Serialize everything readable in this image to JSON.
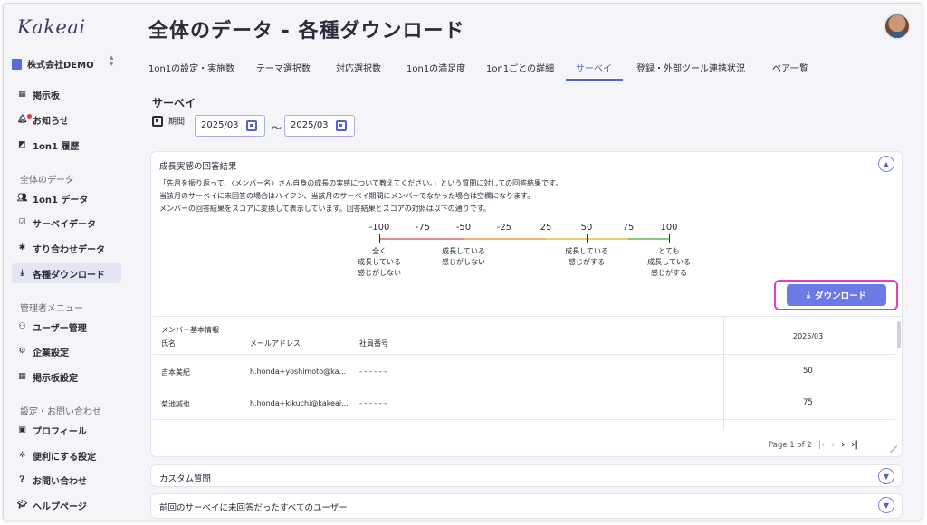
{
  "sidebar": {
    "logo": "Kakeai",
    "company": "株式会社DEMO",
    "items_top": [
      {
        "label": "掲示板",
        "icon": "board-icon"
      },
      {
        "label": "お知らせ",
        "icon": "bell-icon"
      },
      {
        "label": "1on1 履歴",
        "icon": "history-icon"
      }
    ],
    "section_data": "全体のデータ",
    "items_data": [
      {
        "label": "1on1 データ",
        "icon": "people-icon"
      },
      {
        "label": "サーベイデータ",
        "icon": "checkbox-icon"
      },
      {
        "label": "すり合わせデータ",
        "icon": "puzzle-icon"
      },
      {
        "label": "各種ダウンロード",
        "icon": "download-icon"
      }
    ],
    "section_admin": "管理者メニュー",
    "items_admin": [
      {
        "label": "ユーザー管理",
        "icon": "users-icon"
      },
      {
        "label": "企業設定",
        "icon": "building-icon"
      },
      {
        "label": "掲示板設定",
        "icon": "board-settings-icon"
      }
    ],
    "section_settings": "設定・お問い合わせ",
    "items_settings": [
      {
        "label": "プロフィール",
        "icon": "profile-icon"
      },
      {
        "label": "便利にする設定",
        "icon": "gear-icon"
      },
      {
        "label": "お問い合わせ",
        "icon": "help-icon"
      },
      {
        "label": "ヘルプページ",
        "icon": "graduation-icon"
      }
    ]
  },
  "header": {
    "title": "全体のデータ - 各種ダウンロード"
  },
  "tabs": [
    "1on1の設定・実施数",
    "テーマ選択数",
    "対応選択数",
    "1on1の満足度",
    "1on1ごとの詳細",
    "サーベイ",
    "登録・外部ツール連携状況",
    "ペア一覧"
  ],
  "active_tab": "サーベイ",
  "survey": {
    "heading": "サーベイ",
    "period_label": "期間",
    "date_from": "2025/03",
    "date_to": "2025/03",
    "tilde": "〜"
  },
  "growth_card": {
    "title": "成長実感の回答結果",
    "desc1": "「先月を振り返って、〈メンバー名〉さん自身の成長の実感について教えてください。」という質問に対しての回答結果です。",
    "desc2": "当該月のサーベイに未回答の場合はハイフン、当該月のサーベイ期間にメンバーでなかった場合は空欄になります。",
    "desc3": "メンバーの回答結果をスコアに変換して表示しています。回答結果とスコアの対照は以下の通りです。",
    "scale_numbers": [
      "-100",
      "-75",
      "-50",
      "-25",
      "25",
      "50",
      "75",
      "100"
    ],
    "scale_labels": [
      "全く\n成長している\n感じがしない",
      "成長している\n感じがしない",
      "成長している\n感じがする",
      "とても\n成長している\n感じがする"
    ],
    "download_label": "ダウンロード",
    "table": {
      "group_header": "メンバー基本情報",
      "col_name": "氏名",
      "col_email": "メールアドレス",
      "col_empno": "社員番号",
      "col_date": "2025/03",
      "rows": [
        {
          "name": "吉本美紀",
          "email": "h.honda+yoshimoto@ka...",
          "empno": "- - - - - -",
          "value": "50"
        },
        {
          "name": "菊池誠也",
          "email": "h.honda+kikuchi@kakeai...",
          "empno": "- - - - - -",
          "value": "75"
        }
      ]
    },
    "pager_text": "Page 1 of 2"
  },
  "custom_card": {
    "title": "カスタム質問"
  },
  "unanswered_card": {
    "title": "前回のサーベイに未回答だったすべてのユーザー"
  },
  "colors": {
    "accent": "#5562c9",
    "button": "#6b7ae6",
    "highlight": "#e23ec8"
  }
}
